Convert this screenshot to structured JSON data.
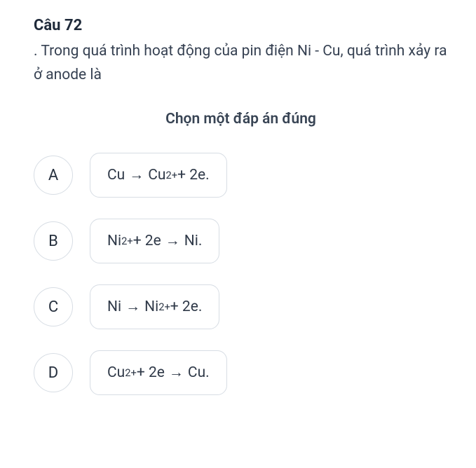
{
  "question": {
    "title": "Câu 72",
    "text": ". Trong quá trình hoạt động của pin điện Ni - Cu, quá trình xảy ra ở anode là"
  },
  "instruction": "Chọn một đáp án đúng",
  "chart_data": {
    "type": "table",
    "options": [
      {
        "letter": "A",
        "equation": "Cu → Cu²⁺ + 2e."
      },
      {
        "letter": "B",
        "equation": "Ni²⁺ + 2e → Ni."
      },
      {
        "letter": "C",
        "equation": "Ni → Ni²⁺ + 2e."
      },
      {
        "letter": "D",
        "equation": "Cu²⁺ + 2e → Cu."
      }
    ]
  },
  "options": [
    {
      "letter": "A",
      "parts": [
        "Cu ",
        "arrow",
        " Cu",
        "sup:2+",
        " + 2e."
      ]
    },
    {
      "letter": "B",
      "parts": [
        "Ni",
        "sup:2+",
        " + 2e ",
        "arrow",
        " Ni."
      ]
    },
    {
      "letter": "C",
      "parts": [
        "Ni ",
        "arrow",
        " Ni",
        "sup:2+",
        " + 2e."
      ]
    },
    {
      "letter": "D",
      "parts": [
        "Cu",
        "sup:2+",
        " + 2e ",
        "arrow",
        " Cu."
      ]
    }
  ],
  "arrow_glyph": "→"
}
